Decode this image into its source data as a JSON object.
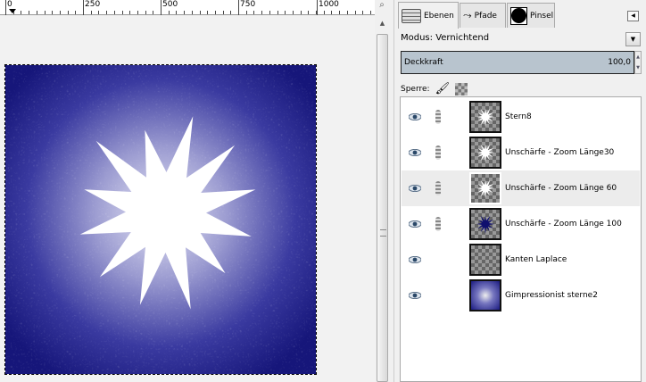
{
  "ruler": {
    "labels": [
      "0",
      "250",
      "500",
      "750",
      "1000"
    ]
  },
  "tabs": [
    {
      "label": "Ebenen"
    },
    {
      "label": "Pfade"
    },
    {
      "label": "Pinsel"
    }
  ],
  "mode": {
    "label": "Modus: Vernichtend"
  },
  "opacity": {
    "label": "Deckkraft",
    "value": "100,0"
  },
  "lock": {
    "label": "Sperre:"
  },
  "layers": [
    {
      "name": "Stern8",
      "thumb": "white-star",
      "linked": true,
      "visible": true,
      "selected": false
    },
    {
      "name": "Unschärfe - Zoom Länge30",
      "thumb": "white-star",
      "linked": true,
      "visible": true,
      "selected": false
    },
    {
      "name": "Unschärfe - Zoom Länge 60",
      "thumb": "white-star",
      "linked": true,
      "visible": true,
      "selected": true
    },
    {
      "name": "Unschärfe - Zoom Länge 100",
      "thumb": "blue-star",
      "linked": true,
      "visible": true,
      "selected": false
    },
    {
      "name": "Kanten Laplace",
      "thumb": "empty",
      "linked": false,
      "visible": true,
      "selected": false
    },
    {
      "name": "Gimpressionist sterne2",
      "thumb": "gradient",
      "linked": false,
      "visible": true,
      "selected": false
    }
  ],
  "colors": {
    "navy": "#1a1a80",
    "selection": "#ececec",
    "opacity_bar": "#b8c4ce"
  }
}
